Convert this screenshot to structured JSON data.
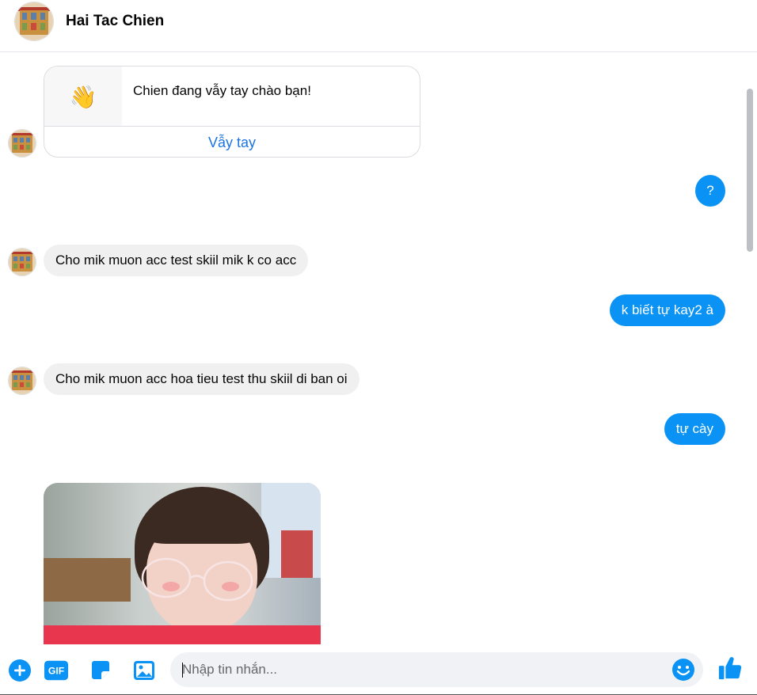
{
  "header": {
    "contact_name": "Hai Tac Chien"
  },
  "wave_card": {
    "emoji": "👋",
    "text": "Chien đang vẫy tay chào bạn!",
    "button_label": "Vẫy tay"
  },
  "messages": [
    {
      "direction": "out",
      "text": "?"
    },
    {
      "direction": "in",
      "text": "Cho mik muon acc test skiil mik k co acc"
    },
    {
      "direction": "out",
      "text": "k biết tự kay2 à"
    },
    {
      "direction": "in",
      "text": "Cho mik muon acc hoa tieu test thu skiil di ban oi"
    },
    {
      "direction": "out",
      "text": "tự cày"
    }
  ],
  "composer": {
    "placeholder": "Nhập tin nhắn...",
    "gif_label": "GIF"
  },
  "colors": {
    "accent": "#0a93f5",
    "incoming_bubble": "#f0f0f0",
    "link": "#1b74e4"
  },
  "icons": [
    "plus-icon",
    "gif-icon",
    "sticker-icon",
    "image-icon",
    "emoji-icon",
    "thumbs-up-icon"
  ]
}
